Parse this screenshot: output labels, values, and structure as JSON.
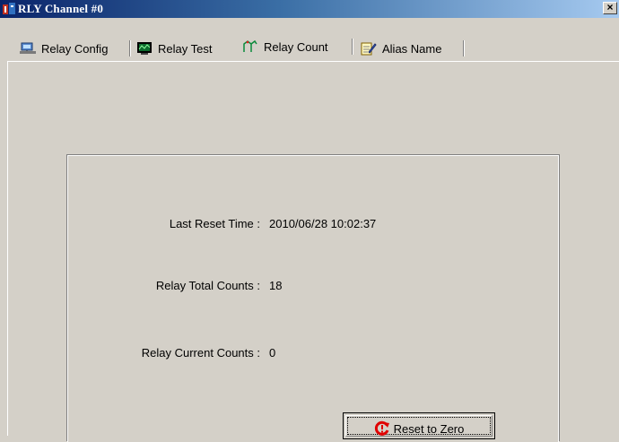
{
  "window": {
    "title": "RLY Channel #0",
    "close_glyph": "×"
  },
  "tabs": [
    {
      "label": "Relay Config",
      "icon": "network-config-icon"
    },
    {
      "label": "Relay Test",
      "icon": "monitor-test-icon"
    },
    {
      "label": "Relay Count",
      "icon": "relay-count-icon",
      "active": true
    },
    {
      "label": "Alias Name",
      "icon": "notepad-pencil-icon"
    }
  ],
  "counts": {
    "last_reset_label": "Last Reset Time :",
    "last_reset_value": "2010/06/28 10:02:37",
    "total_label": "Relay Total Counts :",
    "total_value": "18",
    "current_label": "Relay Current Counts :",
    "current_value": "0"
  },
  "reset_button": {
    "label": "Reset to Zero",
    "icon": "reset-red-icon"
  },
  "colors": {
    "face": "#d4d0c8",
    "title_start": "#0a246a",
    "title_end": "#a6caf0",
    "reset_icon": "#e00000"
  }
}
